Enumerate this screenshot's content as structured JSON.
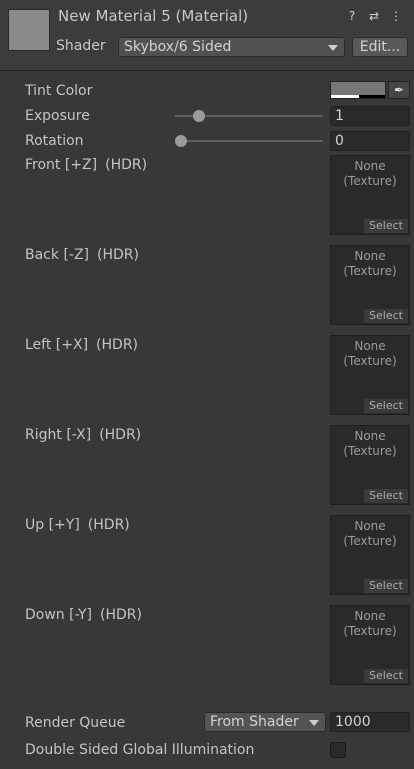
{
  "header": {
    "title": "New Material 5 (Material)",
    "icons": [
      "help-icon",
      "preset-icon",
      "menu-dots-icon"
    ],
    "shader_label": "Shader",
    "shader_value": "Skybox/6 Sided",
    "edit_label": "Edit..."
  },
  "properties": {
    "tint_color": {
      "label": "Tint Color",
      "color": "#777777"
    },
    "exposure": {
      "label": "Exposure",
      "value": "1",
      "slider_fraction": 0.125
    },
    "rotation": {
      "label": "Rotation",
      "value": "0",
      "slider_fraction": 0.0
    }
  },
  "textures": [
    {
      "name": "Front [+Z]",
      "hdr": "(HDR)",
      "none_line1": "None",
      "none_line2": "(Texture)",
      "select": "Select"
    },
    {
      "name": "Back [-Z]",
      "hdr": "(HDR)",
      "none_line1": "None",
      "none_line2": "(Texture)",
      "select": "Select"
    },
    {
      "name": "Left [+X]",
      "hdr": "(HDR)",
      "none_line1": "None",
      "none_line2": "(Texture)",
      "select": "Select"
    },
    {
      "name": "Right [-X]",
      "hdr": "(HDR)",
      "none_line1": "None",
      "none_line2": "(Texture)",
      "select": "Select"
    },
    {
      "name": "Up [+Y]",
      "hdr": "(HDR)",
      "none_line1": "None",
      "none_line2": "(Texture)",
      "select": "Select"
    },
    {
      "name": "Down [-Y]",
      "hdr": "(HDR)",
      "none_line1": "None",
      "none_line2": "(Texture)",
      "select": "Select"
    }
  ],
  "render_queue": {
    "label": "Render Queue",
    "mode": "From Shader",
    "value": "1000"
  },
  "double_sided_gi": {
    "label": "Double Sided Global Illumination",
    "checked": false
  }
}
